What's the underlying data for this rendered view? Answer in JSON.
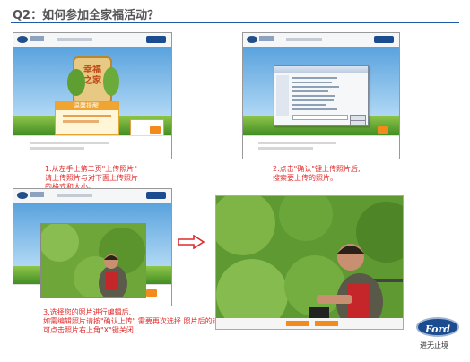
{
  "heading": "Q2：如何参加全家福活动？",
  "colors": {
    "accent": "#1f5aa8",
    "caption": "#e02a2a",
    "button": "#f28a1c",
    "brand": "#1b4c8f"
  },
  "shot1": {
    "sign_text": "幸福之家",
    "popup_title": "温馨提醒",
    "caption_lines": [
      "1.从左手上第二页\"上传照片\"",
      "请上传照片与对下面上传照片",
      "的格式和大小。"
    ]
  },
  "shot2": {
    "caption_lines": [
      "2.点击\"确认\"键上传照片后,",
      "搜索要上传的照片。"
    ]
  },
  "shot3": {
    "caption_lines": [
      "3.选择您的照片进行编辑后,",
      "如需编辑照片请按\"确认上传\" 需要再次选择 照片后的请点\"重新上传\" 如您不想参加",
      "可点击照片右上角\"X\"键关闭"
    ]
  },
  "ford": {
    "logo_text": "Ford",
    "slogan": "进无止境"
  },
  "icons": [
    "arrow-right-icon",
    "ford-logo-icon"
  ]
}
